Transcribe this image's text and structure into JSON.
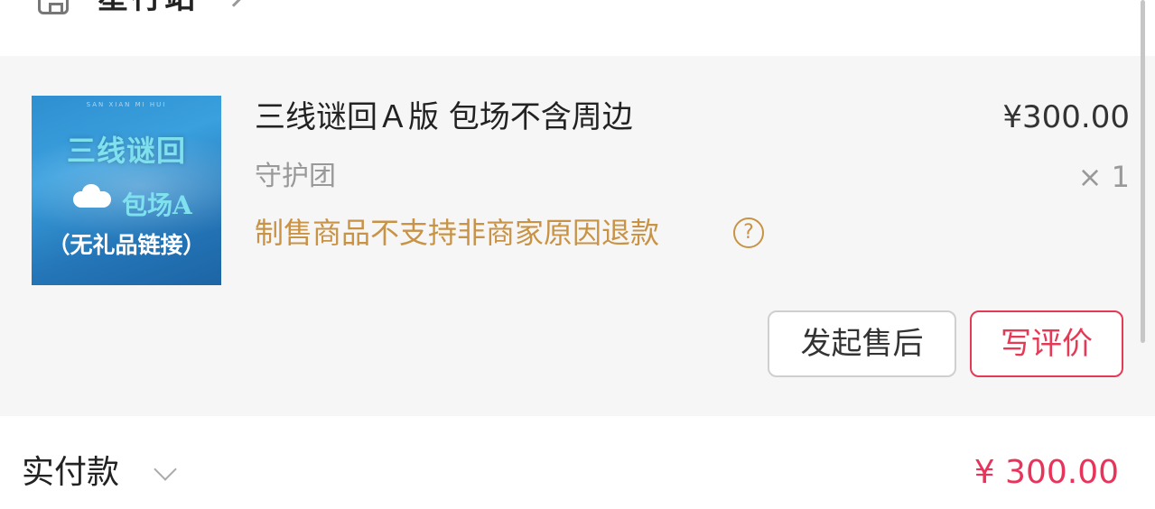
{
  "shop": {
    "name": "星行站",
    "icon": "shop-icon"
  },
  "product": {
    "thumbnail": {
      "small_text": "SAN XIAN MI HUI",
      "title": "三线谜回",
      "subtitle": "包场A",
      "note": "（无礼品链接）"
    },
    "title": "三线谜回Ａ版 包场不含周边",
    "price": "¥300.00",
    "variant": "守护团",
    "quantity": "× 1",
    "refund_note": "制售商品不支持非商家原因退款",
    "help_symbol": "?",
    "accent_color": "#c89345"
  },
  "actions": {
    "after_sale": "发起售后",
    "review": "写评价",
    "review_color": "#e53a55"
  },
  "payment": {
    "label": "实付款",
    "amount": "¥ 300.00",
    "amount_color": "#e8345a"
  }
}
